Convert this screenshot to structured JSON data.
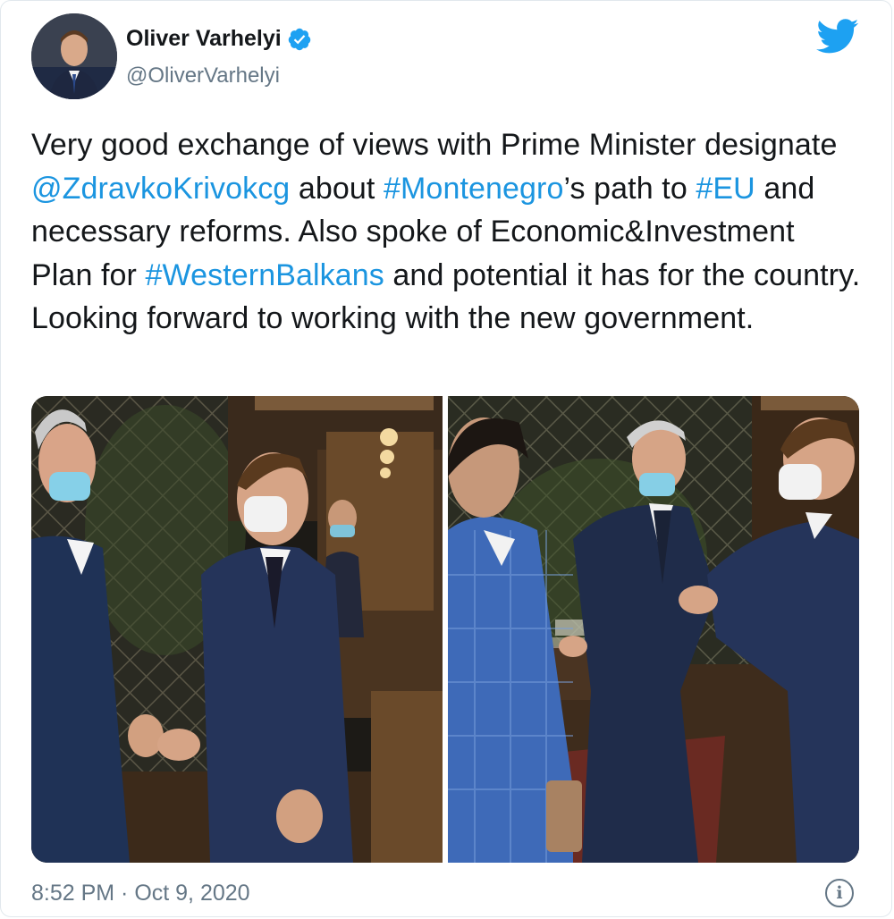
{
  "author": {
    "name": "Oliver Varhelyi",
    "handle": "@OliverVarhelyi",
    "verified_icon": "verified-badge-icon"
  },
  "brand": {
    "icon": "twitter-bird-icon",
    "color": "#1da1f2"
  },
  "tweet": {
    "segments": [
      {
        "text": "Very good exchange of views with Prime Minister designate ",
        "type": "text"
      },
      {
        "text": "@ZdravkoKrivokcg",
        "type": "link"
      },
      {
        "text": " about ",
        "type": "text"
      },
      {
        "text": "#Montenegro",
        "type": "link"
      },
      {
        "text": "’s path to ",
        "type": "text"
      },
      {
        "text": "#EU",
        "type": "link"
      },
      {
        "text": " and necessary reforms. Also spoke of Economic&Investment Plan for ",
        "type": "text"
      },
      {
        "text": "#WesternBalkans",
        "type": "link"
      },
      {
        "text": " and potential it has for the country. Looking forward to working with the new government.",
        "type": "text"
      }
    ],
    "link_color": "#1b95e0"
  },
  "media": {
    "count": 2
  },
  "footer": {
    "timestamp": "8:52 PM · Oct 9, 2020",
    "info_icon": "info-icon",
    "info_glyph": "i"
  }
}
